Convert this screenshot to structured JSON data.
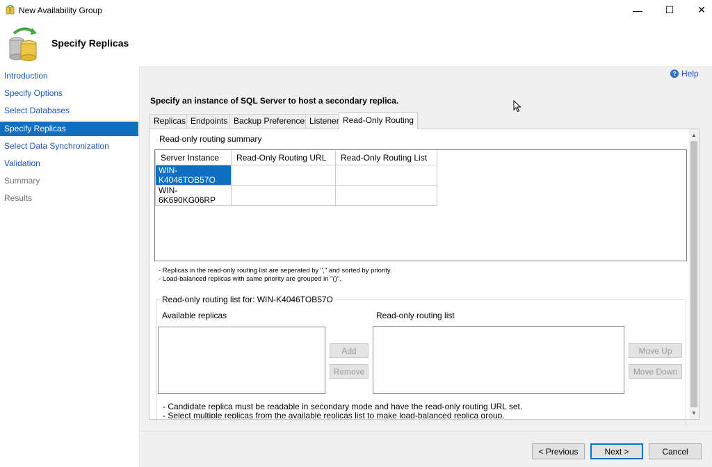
{
  "window": {
    "title": "New Availability Group",
    "minimize_glyph": "—",
    "maximize_glyph": "☐",
    "close_glyph": "✕"
  },
  "header": {
    "page_title": "Specify Replicas",
    "icon": "database-refresh-icon"
  },
  "sidebar": {
    "items": [
      {
        "label": "Introduction",
        "state": "link"
      },
      {
        "label": "Specify Options",
        "state": "link"
      },
      {
        "label": "Select Databases",
        "state": "link"
      },
      {
        "label": "Specify Replicas",
        "state": "active"
      },
      {
        "label": "Select Data Synchronization",
        "state": "link"
      },
      {
        "label": "Validation",
        "state": "link"
      },
      {
        "label": "Summary",
        "state": "disabled"
      },
      {
        "label": "Results",
        "state": "disabled"
      }
    ]
  },
  "help": {
    "label": "Help",
    "glyph": "?"
  },
  "instruction": "Specify an instance of SQL Server to host a secondary replica.",
  "tabs": [
    {
      "label": "Replicas"
    },
    {
      "label": "Endpoints"
    },
    {
      "label": "Backup Preferences"
    },
    {
      "label": "Listener"
    },
    {
      "label": "Read-Only Routing",
      "active": true
    }
  ],
  "routing": {
    "summary_label": "Read-only routing summary",
    "columns": [
      "Server Instance",
      "Read-Only Routing URL",
      "Read-Only Routing List"
    ],
    "rows": [
      {
        "server": "WIN-K4046TOB57O",
        "url": "",
        "list": "",
        "selected": true
      },
      {
        "server": "WIN-6K690KG06RP",
        "url": "",
        "list": "",
        "selected": false
      }
    ],
    "notes": [
      "- Replicas in the read-only routing list are seperated by \",\" and sorted by priority.",
      "- Load-balanced replicas with same priority are grouped in \"()\"."
    ]
  },
  "routing_list": {
    "caption": "Read-only routing list for: WIN-K4046TOB57O",
    "available_label": "Available replicas",
    "list_label": "Read-only routing list",
    "add_label": "Add",
    "remove_label": "Remove",
    "move_up_label": "Move Up",
    "move_down_label": "Move Down",
    "notes": [
      "- Candidate replica must be readable in secondary mode and have the read-only routing URL set.",
      "- Select multiple replicas from the available replicas list to make load-balanced replica group."
    ]
  },
  "scrollbar": {
    "up_glyph": "▲",
    "down_glyph": "▼"
  },
  "footer": {
    "previous_label": "< Previous",
    "next_label": "Next >",
    "cancel_label": "Cancel"
  },
  "colors": {
    "accent": "#0e6fc3",
    "link": "#1a54b6",
    "panel_bg": "#f0f0f0"
  }
}
